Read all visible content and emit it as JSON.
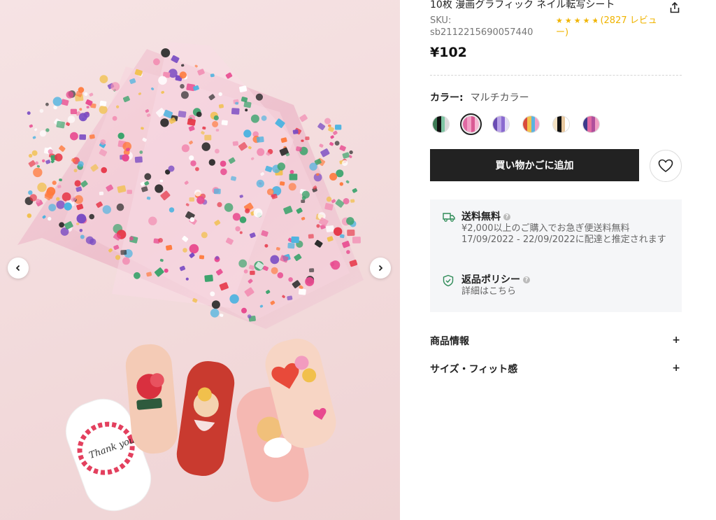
{
  "gallery": {
    "prev_arrow": "‹",
    "next_arrow": "›",
    "nail_text": "Thank you"
  },
  "product": {
    "title": "10枚 漫画グラフィック ネイル転写シート",
    "sku_label": "SKU:",
    "sku_value": "sb2112215690057440",
    "rating_stars": 4.5,
    "rating_count": "(2827 レビュー)",
    "price": "¥102"
  },
  "color": {
    "label": "カラー:",
    "value": "マルチカラー",
    "swatches": [
      {
        "name": "swatch-1",
        "colors": [
          "#3d7a55",
          "#111111",
          "#7fc6a4",
          "#d9d9d9"
        ]
      },
      {
        "name": "swatch-2",
        "colors": [
          "#e06aa3",
          "#f29fc5",
          "#d95a94",
          "#f7b8d4"
        ],
        "selected": true
      },
      {
        "name": "swatch-3",
        "colors": [
          "#6a4cb3",
          "#b9a3e6",
          "#8a6ad0",
          "#e3dbf7"
        ]
      },
      {
        "name": "swatch-4",
        "colors": [
          "#d94b3c",
          "#f2c14e",
          "#5ab4e0",
          "#f29fc5"
        ]
      },
      {
        "name": "swatch-5",
        "colors": [
          "#f3e1c2",
          "#111111",
          "#e8c9a0",
          "#ffffff"
        ]
      },
      {
        "name": "swatch-6",
        "colors": [
          "#3d3a8c",
          "#e06aa3",
          "#b04f9c",
          "#f29fc5"
        ]
      }
    ]
  },
  "actions": {
    "add_to_cart": "買い物かごに追加"
  },
  "shipping": {
    "title": "送料無料",
    "line1": "¥2,000以上のご購入でお急ぎ便送料無料",
    "line2": "17/09/2022 - 22/09/2022に配達と推定されます",
    "return_title": "返品ポリシー",
    "return_sub": "詳細はこちら",
    "help_glyph": "?"
  },
  "accordion": [
    {
      "label": "商品情報",
      "icon": "+"
    },
    {
      "label": "サイズ・フィット感",
      "icon": "+"
    }
  ],
  "colors": {
    "button_bg": "#222222",
    "star": "#f0b400",
    "ship_icon": "#2e8b57",
    "panel_bg": "#f5f6f8"
  }
}
